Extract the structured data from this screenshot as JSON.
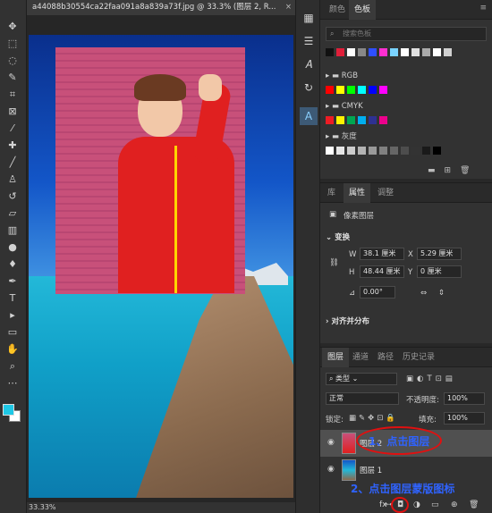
{
  "document": {
    "tab_title": "a44088b30554ca22faa091a8a839a73f.jpg @ 33.3% (图层 2, R...",
    "close_glyph": "×",
    "zoom_status": "33.33%"
  },
  "colors": {
    "foreground": "#1ec8e6",
    "background": "#ffffff",
    "annotation_blue": "#2f63ff",
    "annotation_red": "#e01010"
  },
  "tools": [
    {
      "name": "move-tool-icon",
      "glyph": "✥"
    },
    {
      "name": "marquee-tool-icon",
      "glyph": "⬚"
    },
    {
      "name": "lasso-tool-icon",
      "glyph": "◌"
    },
    {
      "name": "quick-select-tool-icon",
      "glyph": "✎"
    },
    {
      "name": "crop-tool-icon",
      "glyph": "⌗"
    },
    {
      "name": "frame-tool-icon",
      "glyph": "⊠"
    },
    {
      "name": "eyedropper-tool-icon",
      "glyph": "⁄"
    },
    {
      "name": "healing-brush-tool-icon",
      "glyph": "✚"
    },
    {
      "name": "brush-tool-icon",
      "glyph": "╱"
    },
    {
      "name": "clone-stamp-tool-icon",
      "glyph": "♙"
    },
    {
      "name": "history-brush-tool-icon",
      "glyph": "↺"
    },
    {
      "name": "eraser-tool-icon",
      "glyph": "▱"
    },
    {
      "name": "gradient-tool-icon",
      "glyph": "▥"
    },
    {
      "name": "blur-tool-icon",
      "glyph": "●"
    },
    {
      "name": "dodge-tool-icon",
      "glyph": "♦"
    },
    {
      "name": "pen-tool-icon",
      "glyph": "✒"
    },
    {
      "name": "type-tool-icon",
      "glyph": "T"
    },
    {
      "name": "path-select-tool-icon",
      "glyph": "▸"
    },
    {
      "name": "rectangle-tool-icon",
      "glyph": "▭"
    },
    {
      "name": "hand-tool-icon",
      "glyph": "✋"
    },
    {
      "name": "zoom-tool-icon",
      "glyph": "⌕"
    },
    {
      "name": "more-tools-icon",
      "glyph": "⋯"
    }
  ],
  "swatches_panel": {
    "tabs": [
      "颜色",
      "色板"
    ],
    "active_tab": "色板",
    "search_placeholder": "搜索色板",
    "recent_colors": [
      "#111111",
      "#e01f3a",
      "#ffffff",
      "#888888",
      "#2e4fff",
      "#ff2fd1",
      "#7ad3ff",
      "#ffffff",
      "#e0e0e0",
      "#aaaaaa",
      "#ffffff",
      "#d0d0d0"
    ],
    "groups": [
      {
        "label": "RGB",
        "colors": [
          "#ff0000",
          "#ffff00",
          "#00ff00",
          "#00ffff",
          "#0000ff",
          "#ff00ff"
        ]
      },
      {
        "label": "CMYK",
        "colors": [
          "#ee1c24",
          "#fff200",
          "#00a651",
          "#00aeef",
          "#2e3192",
          "#ec008c"
        ]
      },
      {
        "label": "灰度",
        "colors": [
          "#ffffff",
          "#e6e6e6",
          "#cccccc",
          "#b3b3b3",
          "#999999",
          "#808080",
          "#666666",
          "#4d4d4d",
          "#333333",
          "#1a1a1a",
          "#000000"
        ]
      }
    ]
  },
  "properties_panel": {
    "tabs": [
      "库",
      "属性",
      "调整"
    ],
    "active_tab": "属性",
    "layer_type": "像素图层",
    "transform_heading": "变换",
    "w_label": "W",
    "w_value": "38.1 厘米",
    "x_label": "X",
    "x_value": "5.29 厘米",
    "h_label": "H",
    "h_value": "48.44 厘米",
    "y_label": "Y",
    "y_value": "0 厘米",
    "angle_value": "0.00°",
    "align_heading": "对齐并分布"
  },
  "layers_panel": {
    "tabs": [
      "图层",
      "通道",
      "路径",
      "历史记录"
    ],
    "active_tab": "图层",
    "filter_kind": "类型",
    "blend_mode": "正常",
    "opacity_label": "不透明度:",
    "opacity_value": "100%",
    "lock_label": "锁定:",
    "fill_label": "填充:",
    "fill_value": "100%",
    "layers": [
      {
        "name": "图层 2",
        "selected": true
      },
      {
        "name": "图层 1",
        "selected": false
      }
    ],
    "footer_link": "⊶",
    "footer_fx": "fx",
    "footer_mask": "◘",
    "footer_adjust": "◑",
    "footer_group": "▭",
    "footer_new": "⊕",
    "footer_delete": "🗑"
  },
  "annotations": {
    "step1": "1、点击图层",
    "step2": "2、点击图层蒙版图标"
  }
}
